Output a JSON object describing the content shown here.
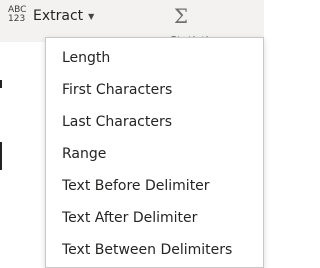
{
  "ribbon": {
    "extract_button": {
      "icon_top": "ABC",
      "icon_bottom": "123",
      "label": "Extract"
    },
    "statistics_peek": "Statistics"
  },
  "menu": {
    "items": [
      {
        "label": "Length"
      },
      {
        "label": "First Characters"
      },
      {
        "label": "Last Characters"
      },
      {
        "label": "Range"
      },
      {
        "label": "Text Before Delimiter"
      },
      {
        "label": "Text After Delimiter"
      },
      {
        "label": "Text Between Delimiters"
      }
    ]
  }
}
